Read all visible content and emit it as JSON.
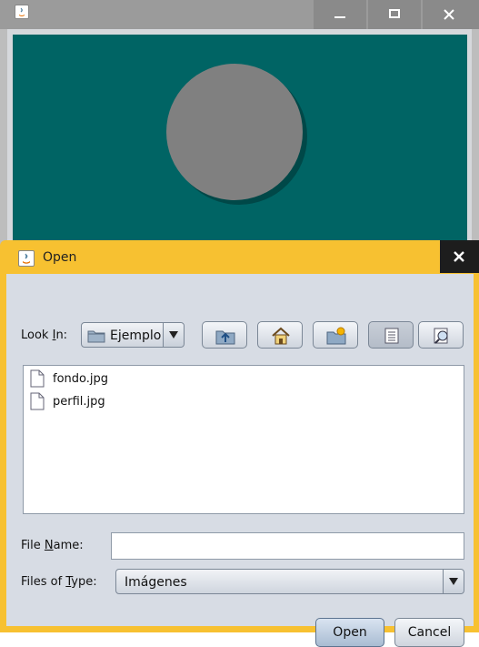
{
  "dialog": {
    "title": "Open",
    "look_in_label_pre": "Look ",
    "look_in_label_mn": "I",
    "look_in_label_post": "n:",
    "look_in_value": "Ejemplo",
    "toolbar_icons": [
      "up-folder-icon",
      "home-icon",
      "new-folder-icon",
      "list-view-icon",
      "details-view-icon"
    ],
    "files": [
      {
        "name": "fondo.jpg",
        "icon": "file-icon"
      },
      {
        "name": "perfil.jpg",
        "icon": "file-icon"
      }
    ],
    "file_name_label_pre": "File ",
    "file_name_label_mn": "N",
    "file_name_label_post": "ame:",
    "file_name_value": "",
    "files_of_type_label_pre": "Files of ",
    "files_of_type_label_mn": "T",
    "files_of_type_label_post": "ype:",
    "files_of_type_value": "Imágenes",
    "open_button": "Open",
    "cancel_button": "Cancel"
  },
  "colors": {
    "dialog_frame": "#f7c131",
    "canvas_background": "#006464",
    "circle": "#808080",
    "circle_shadow": "#004848",
    "dialog_body": "#d7dce4"
  }
}
